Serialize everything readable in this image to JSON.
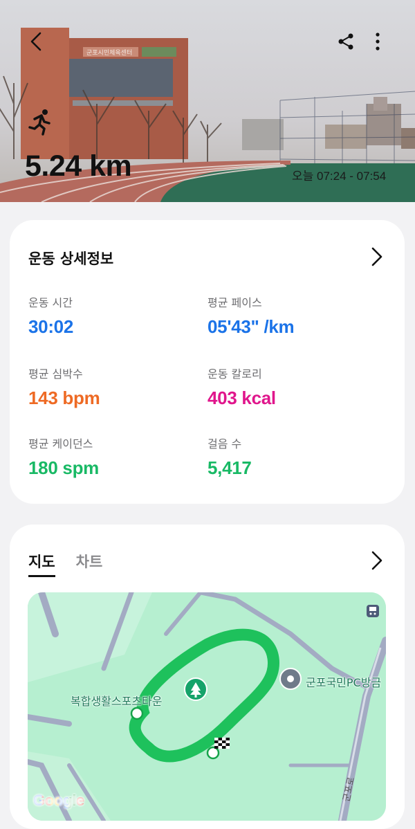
{
  "hero": {
    "distance": "5.24 km",
    "time_range": "오늘 07:24 - 07:54",
    "building_sign": "군포시민체육센터"
  },
  "icons": {
    "back": "chevron-left-icon",
    "share": "share-icon",
    "more": "more-vertical-icon",
    "activity": "running-icon",
    "details_open": "chevron-right-icon",
    "map_open": "chevron-right-icon",
    "forest_marker": "tree-marker-icon",
    "place_marker": "place-pin-icon",
    "bus": "bus-icon",
    "finish": "checkered-flag-icon"
  },
  "details": {
    "title": "운동 상세정보",
    "stats": [
      {
        "label": "운동 시간",
        "value": "30:02",
        "color": "#1b73e8"
      },
      {
        "label": "평균 페이스",
        "value": "05'43\" /km",
        "color": "#1b73e8"
      },
      {
        "label": "평균 심박수",
        "value": "143 bpm",
        "color": "#ee6a24"
      },
      {
        "label": "운동 칼로리",
        "value": "403 kcal",
        "color": "#e0168c"
      },
      {
        "label": "평균 케이던스",
        "value": "180 spm",
        "color": "#19b965"
      },
      {
        "label": "걸음 수",
        "value": "5,417",
        "color": "#19b965"
      }
    ]
  },
  "map_section": {
    "tabs": [
      {
        "label": "지도",
        "active": true
      },
      {
        "label": "차트",
        "active": false
      }
    ],
    "labels": {
      "sports_town": "복합생활스포츠타운",
      "pc_room": "군포국민PC방금",
      "road": "군포로",
      "google": "Google"
    },
    "route_color": "#1ec15c"
  }
}
